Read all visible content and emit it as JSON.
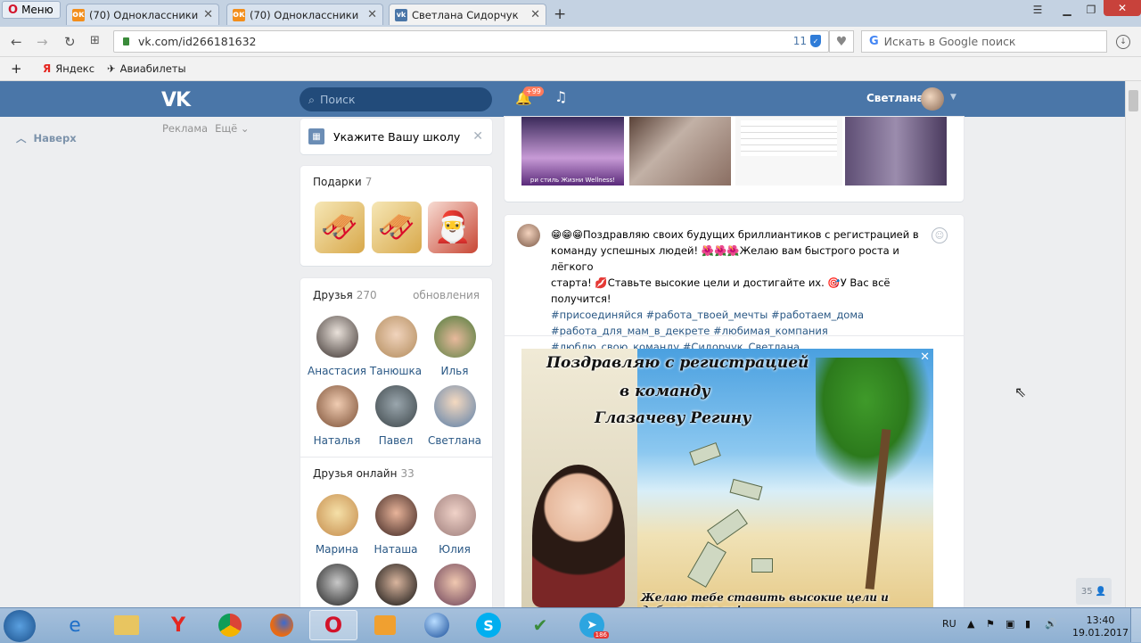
{
  "browser": {
    "menu_label": "Меню",
    "tabs": [
      {
        "title": "(70) Одноклассники"
      },
      {
        "title": "(70) Одноклассники"
      },
      {
        "title": "Светлана Сидорчук"
      }
    ],
    "url": "vk.com/id266181632",
    "url_counter": "11",
    "search_placeholder": "Искать в Google поиск",
    "bookmarks": [
      {
        "label": "Яндекс"
      },
      {
        "label": "Авиабилеты"
      }
    ]
  },
  "vk": {
    "search_placeholder": "Поиск",
    "notifications_badge": "+99",
    "user_name": "Светлана",
    "back_to_top": "Наверх",
    "ads_label": "Реклама",
    "more_label": "Ещё"
  },
  "sidebar": {
    "school_prompt": "Укажите Вашу школу",
    "gifts": {
      "title": "Подарки",
      "count": "7"
    },
    "friends": {
      "title": "Друзья",
      "count": "270",
      "updates": "обновления",
      "items": [
        {
          "name": "Анастасия"
        },
        {
          "name": "Танюшка"
        },
        {
          "name": "Илья"
        },
        {
          "name": "Наталья"
        },
        {
          "name": "Павел"
        },
        {
          "name": "Светлана"
        }
      ]
    },
    "friends_online": {
      "title": "Друзья онлайн",
      "count": "33",
      "items": [
        {
          "name": "Марина"
        },
        {
          "name": "Наташа"
        },
        {
          "name": "Юлия"
        }
      ]
    }
  },
  "post": {
    "thumb_caption": "ри стиль Жизни Wellness!",
    "text_lines": [
      "😁😁😁Поздравляю своих будущих бриллиантиков с регистрацией в",
      "команду успешных людей! 🌺🌺🌺Желаю вам быстрого роста и лёгкого",
      "старта! 💋Ставьте высокие цели и достигайте их. 🎯У Вас всё получится!"
    ],
    "hashtag_lines": [
      "#присоединяйся #работа_твоей_мечты #работаем_дома",
      "#работа_для_мам_в_декрете #любимая_компания",
      "#люблю_свою_команду #Сидорчук_Светлана"
    ],
    "banner": {
      "line1": "Поздравляю с регистрацией",
      "line2": "в команду",
      "line3": "Глазачеву Регину",
      "bottom": "Желаю тебе ставить высокие цели и добиваться их!"
    }
  },
  "chat_count": "35",
  "taskbar": {
    "lang": "RU",
    "time": "13:40",
    "date": "19.01.2017",
    "telegram_badge": "186"
  }
}
